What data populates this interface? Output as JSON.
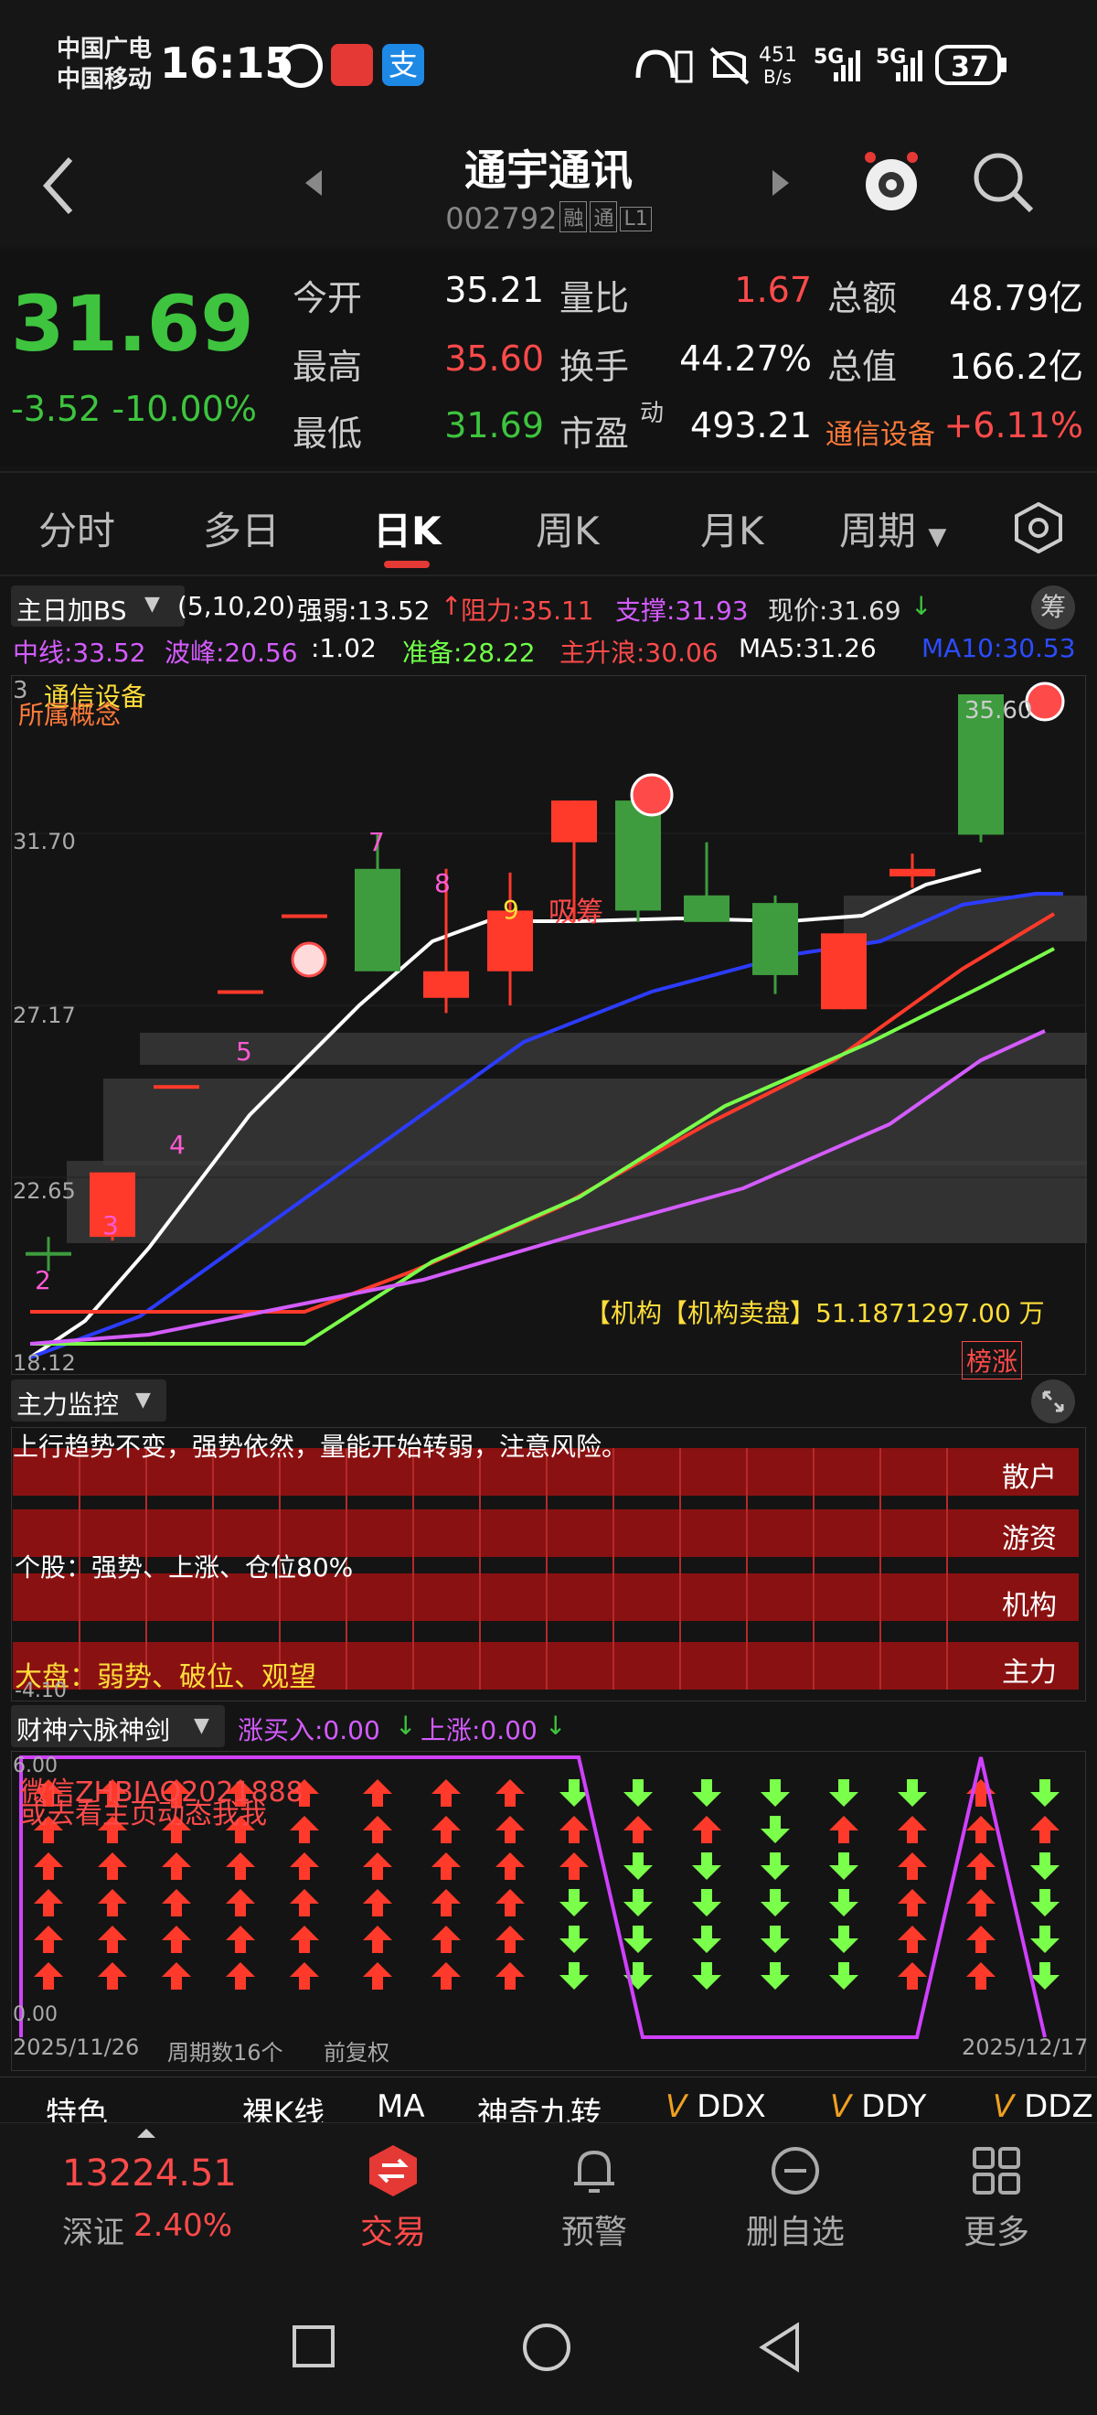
{
  "status_bar": {
    "carrier1": "中国广电",
    "carrier2": "中国移动",
    "time": "16:15",
    "net_speed_top": "451",
    "net_speed_bottom": "B/s",
    "net1": "5G",
    "net2": "5G",
    "battery": "37"
  },
  "header": {
    "title": "通宇通讯",
    "code": "002792",
    "tags": [
      "融",
      "通",
      "L1"
    ]
  },
  "quote": {
    "price": "31.69",
    "change": "-3.52  -10.00%",
    "labels": [
      "今开",
      "最高",
      "最低",
      "量比",
      "换手",
      "市盈",
      "总额",
      "总值"
    ],
    "open": "35.21",
    "high": "35.60",
    "low": "31.69",
    "vol_ratio": "1.67",
    "turnover": "44.27%",
    "pe_sup": "动",
    "pe": "493.21",
    "amount": "48.79亿",
    "market_cap": "166.2亿",
    "sector": "通信设备",
    "sector_change": "+6.11%"
  },
  "tabs": [
    "分时",
    "多日",
    "日K",
    "周K",
    "月K",
    "周期"
  ],
  "indicator": {
    "name": "主日加BS",
    "params": "(5,10,20)",
    "strong": "强弱:13.52",
    "resist": "阻力:35.11",
    "support": "支撑:31.93",
    "current": "现价:31.69",
    "chip": "筹",
    "mid": "中线:33.52",
    "peak": "波峰:20.56",
    "ratio": ":1.02",
    "prep": "准备:28.22",
    "wave": "主升浪:30.06",
    "ma5": "MA5:31.26",
    "ma10": "MA10:30.53"
  },
  "kline": {
    "y_labels": [
      "31.70",
      "27.17",
      "22.65",
      "18.12"
    ],
    "top_label": "3",
    "concept1": "通信设备",
    "concept2": "所属概念",
    "top_value": "35.60",
    "xichou": "吸筹",
    "inst": "【机构【机构卖盘】51.1871297.00 万",
    "bangzhang": "榜涨",
    "counts": [
      "2",
      "3",
      "4",
      "5",
      "7",
      "8",
      "9"
    ]
  },
  "chart_data": {
    "type": "candlestick",
    "title": "",
    "ylim": [
      18.12,
      35.6
    ],
    "candles": [
      {
        "o": 20.9,
        "c": 20.9,
        "h": 21.3,
        "l": 20.4,
        "color": "green"
      },
      {
        "o": 21.3,
        "c": 23.0,
        "h": 23.0,
        "l": 21.2,
        "color": "red"
      },
      {
        "o": 25.3,
        "c": 25.3,
        "h": 25.3,
        "l": 25.3,
        "color": "red"
      },
      {
        "o": 27.8,
        "c": 27.8,
        "h": 27.8,
        "l": 27.8,
        "color": "red"
      },
      {
        "o": 29.8,
        "c": 29.8,
        "h": 29.8,
        "l": 29.8,
        "color": "red"
      },
      {
        "o": 31.0,
        "c": 28.3,
        "h": 31.9,
        "l": 28.3,
        "color": "green"
      },
      {
        "o": 28.3,
        "c": 27.6,
        "h": 31.0,
        "l": 27.2,
        "color": "red"
      },
      {
        "o": 28.3,
        "c": 29.9,
        "h": 30.9,
        "l": 27.4,
        "color": "red"
      },
      {
        "o": 32.8,
        "c": 31.7,
        "h": 32.8,
        "l": 29.6,
        "color": "red"
      },
      {
        "o": 29.9,
        "c": 32.8,
        "h": 32.8,
        "l": 29.6,
        "color": "green"
      },
      {
        "o": 29.6,
        "c": 30.3,
        "h": 31.7,
        "l": 29.6,
        "color": "green"
      },
      {
        "o": 28.2,
        "c": 30.1,
        "h": 30.3,
        "l": 27.7,
        "color": "green"
      },
      {
        "o": 29.3,
        "c": 27.3,
        "h": 29.3,
        "l": 27.3,
        "color": "red"
      },
      {
        "o": 31.0,
        "c": 30.8,
        "h": 31.4,
        "l": 30.5,
        "color": "red"
      },
      {
        "o": 31.9,
        "c": 35.6,
        "h": 35.6,
        "l": 31.7,
        "color": "green"
      }
    ]
  },
  "monitor": {
    "name": "主力监控",
    "text1": "上行趋势不变，强势依然，量能开始转弱，注意风险。",
    "text2": "个股：强势、上涨、仓位80%",
    "text3": "大盘：弱势、破位、观望",
    "rows": [
      "散户",
      "游资",
      "机构",
      "主力"
    ],
    "ymin": "-4.10",
    "ymax": "3"
  },
  "bottom_ind": {
    "name": "财神六脉神剑",
    "buy": "涨买入:0.00",
    "up": "上涨:0.00",
    "ymax": "6.00",
    "ymin": "0.00",
    "note1": "微信ZHBIAO2021888",
    "note2": "或去看主页动态我我"
  },
  "date_bar": {
    "start": "2025/11/26",
    "periods": "周期数16个",
    "adj": "前复权",
    "end": "2025/12/17"
  },
  "strip": [
    "特色",
    "裸K线",
    "MA",
    "神奇九转",
    "DDX",
    "DDY",
    "DDZ"
  ],
  "nav": {
    "index_value": "13224.51",
    "index_name": "深证",
    "index_change": "2.40%",
    "items": [
      "交易",
      "预警",
      "删自选",
      "更多"
    ]
  }
}
